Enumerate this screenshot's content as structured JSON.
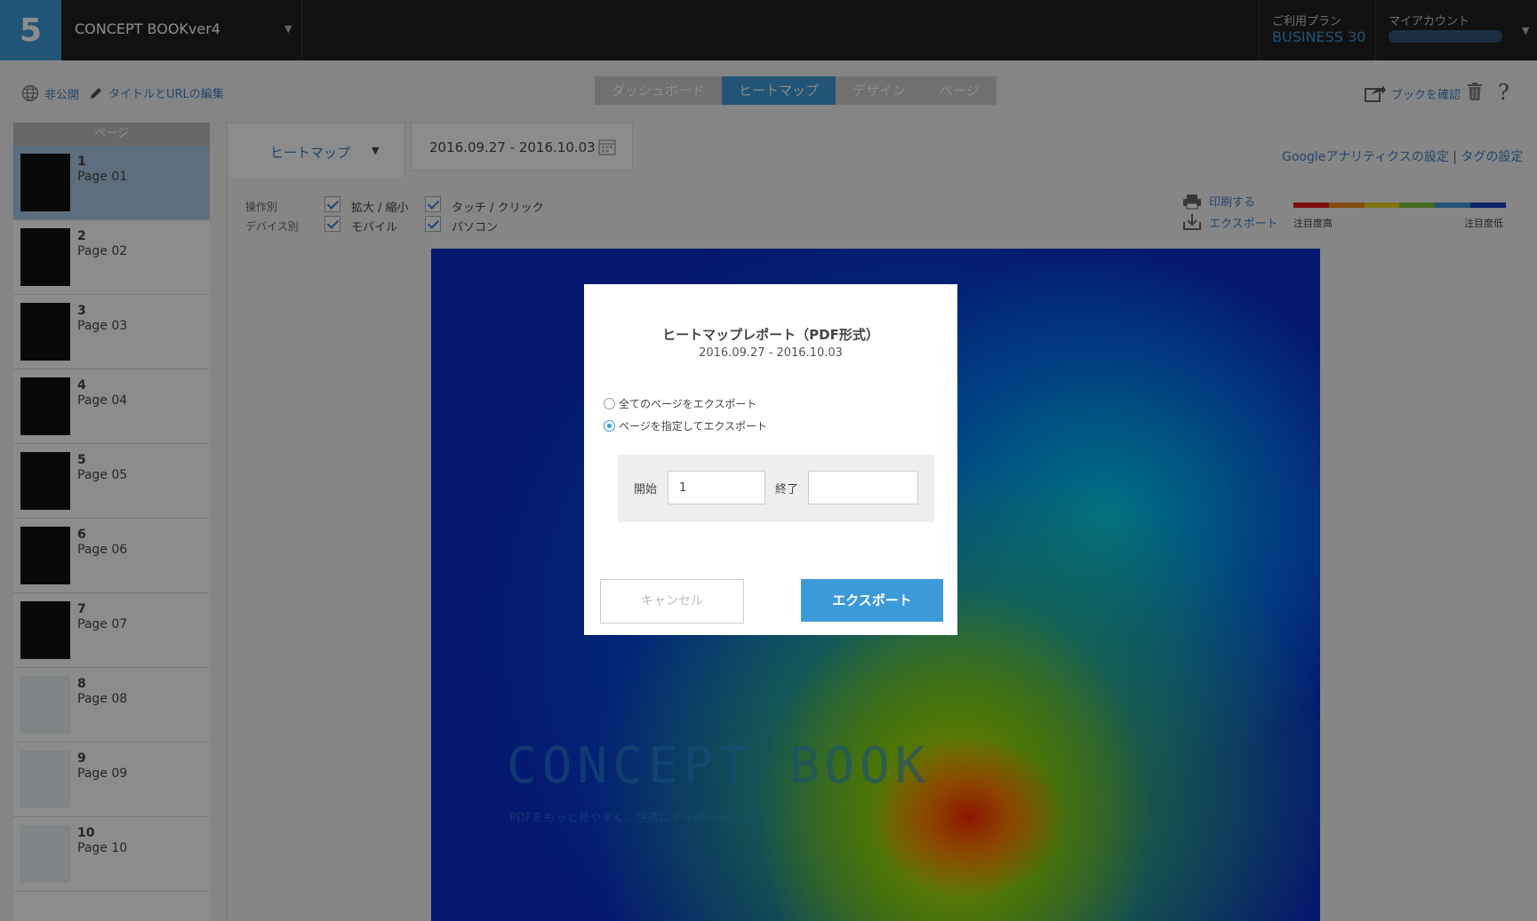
{
  "app": {
    "logo": "5",
    "book_title": "CONCEPT BOOKver4"
  },
  "header": {
    "plan_label": "ご利用プラン",
    "plan_value": "BUSINESS 30",
    "account_label": "マイアカウント"
  },
  "toolbar": {
    "visibility": "非公開",
    "edit_title": "タイトルとURLの編集",
    "view_book": "ブックを確認",
    "help": "?"
  },
  "tabs": [
    {
      "label": "ダッシュボード"
    },
    {
      "label": "ヒートマップ"
    },
    {
      "label": "デザイン"
    },
    {
      "label": "ページ"
    }
  ],
  "sidebar": {
    "header": "ページ",
    "pages": [
      {
        "num": "1",
        "name": "Page 01"
      },
      {
        "num": "2",
        "name": "Page 02"
      },
      {
        "num": "3",
        "name": "Page 03"
      },
      {
        "num": "4",
        "name": "Page 04"
      },
      {
        "num": "5",
        "name": "Page 05"
      },
      {
        "num": "6",
        "name": "Page 06"
      },
      {
        "num": "7",
        "name": "Page 07"
      },
      {
        "num": "8",
        "name": "Page 08"
      },
      {
        "num": "9",
        "name": "Page 09"
      },
      {
        "num": "10",
        "name": "Page 10"
      }
    ]
  },
  "heatmap_view": {
    "type_select": "ヒートマップ",
    "date_range": "2016.09.27 - 2016.10.03",
    "ga_settings": "Googleアナリティクスの設定",
    "separator": "|",
    "tag_settings": "タグの設定",
    "filter_by_action": "操作別",
    "filter_by_device": "デバイス別",
    "check_zoom": "拡大 / 縮小",
    "check_touch": "タッチ / クリック",
    "check_mobile": "モバイル",
    "check_pc": "パソコン",
    "print": "印刷する",
    "export": "エクスポート",
    "legend_high": "注目度高",
    "legend_low": "注目度低",
    "legend_colors": [
      "#e02020",
      "#f08a20",
      "#e8d020",
      "#7cc43c",
      "#3d9ad9",
      "#1a3fc0"
    ],
    "page_title_text": "CONCEPT BOOK",
    "page_sub_text": "PDFをもっと見やすく、快適にするebook5とは"
  },
  "modal": {
    "title": "ヒートマップレポート（PDF形式）",
    "date_range": "2016.09.27 - 2016.10.03",
    "option_all": "全てのページをエクスポート",
    "option_range": "ページを指定してエクスポート",
    "selected_option": "range",
    "start_label": "開始",
    "start_value": "1",
    "end_label": "終了",
    "end_value": "",
    "cancel": "キャンセル",
    "export": "エクスポート"
  }
}
